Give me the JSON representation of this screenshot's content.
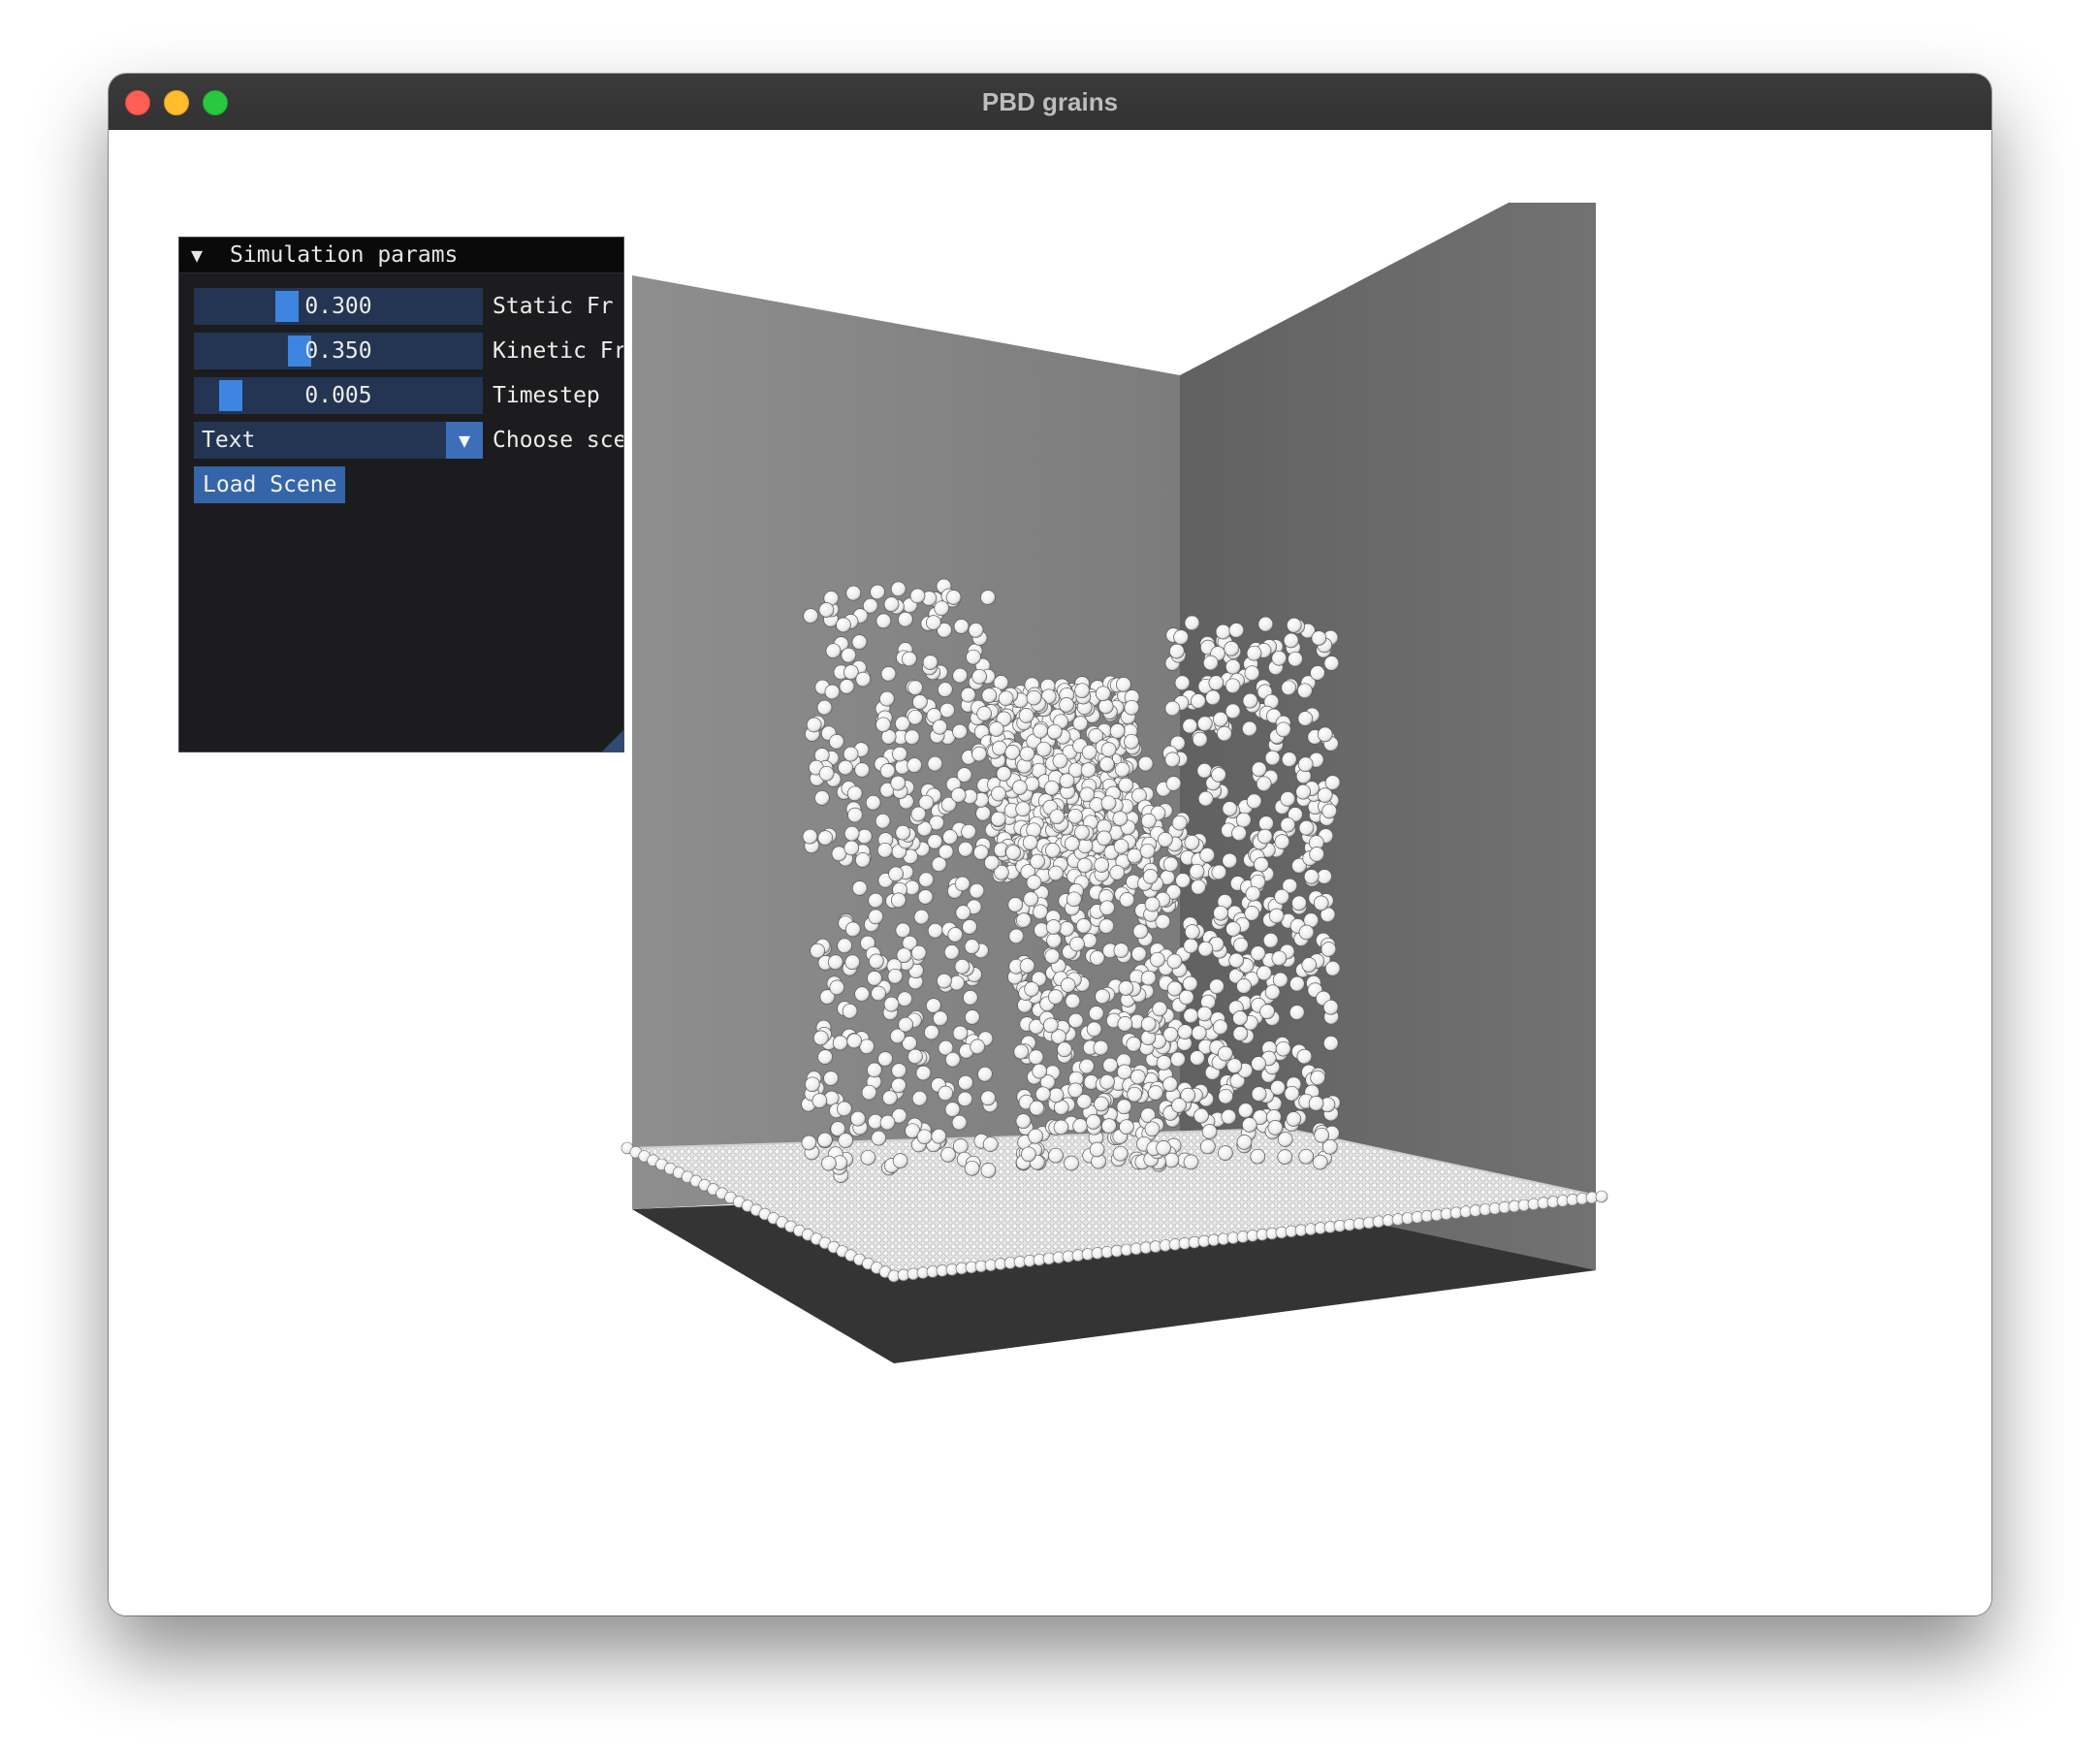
{
  "window": {
    "title": "PBD grains",
    "controls": [
      "close",
      "minimize",
      "zoom"
    ]
  },
  "panel": {
    "collapse_icon": "triangle-down-icon",
    "title": "Simulation params",
    "static_friction": {
      "value": "0.300",
      "label": "Static Fr",
      "fraction": 0.3
    },
    "kinetic_friction": {
      "value": "0.350",
      "label": "Kinetic Fr",
      "fraction": 0.35
    },
    "timestep": {
      "value": "0.005",
      "label": "Timestep",
      "fraction": 0.05
    },
    "scene_select": {
      "value": "Text",
      "label": "Choose sce",
      "arrow_icon": "triangle-down-icon"
    },
    "load_button": "Load Scene"
  },
  "scene": {
    "description_colors": {
      "back_wall": "#8c8c8c",
      "right_wall": "#686868",
      "floor": "#343434",
      "grain": "#f4f4f4"
    }
  }
}
